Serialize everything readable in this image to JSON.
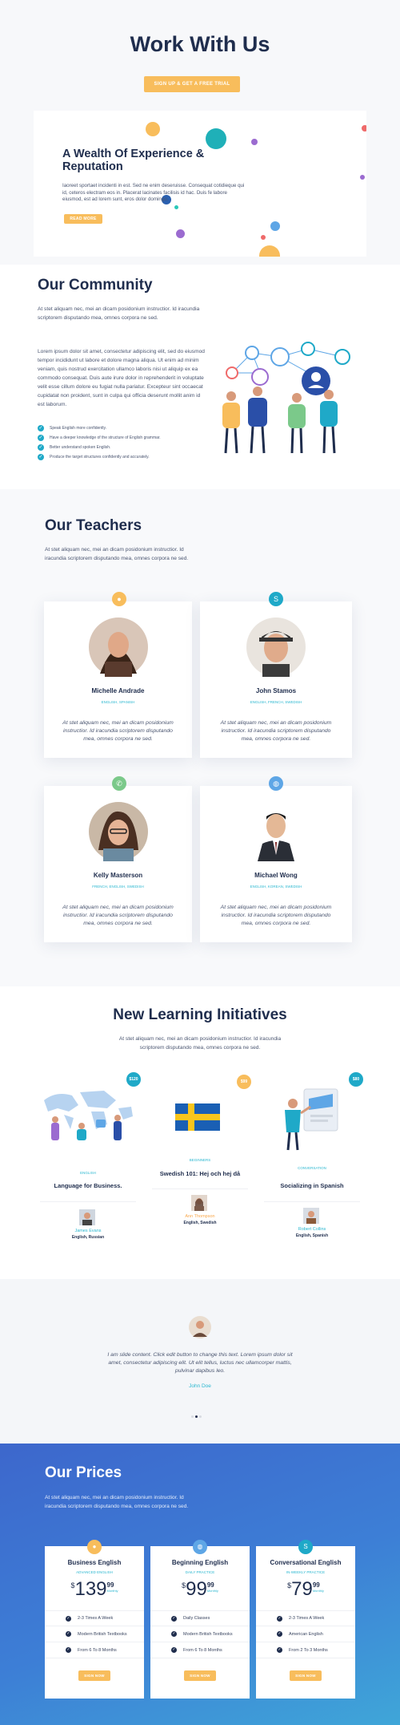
{
  "hero": {
    "title": "Work With Us",
    "cta": "SIGN UP & GET A FREE TRIAL"
  },
  "slider": {
    "heading": "A Wealth Of Experience & Reputation",
    "text": "Iaoreet sportaet incidenti in est. Sed ne enim deseruisse. Consequat cotidieque qui id, ceteros electram eos in. Placerat lacinates facilisis id hac. Duis fe labore eiusmod, est ad lorem sunt, eros dolor domingo.",
    "button": "READ MORE"
  },
  "community": {
    "title": "Our Community",
    "intro": "At stet aliquam nec, mei an dicam posidonium instructior. Id iracundia scriptorem disputando mea, omnes corpora ne sed.",
    "body": "Lorem ipsum dolor sit amet, consectetur adipiscing elit, sed do eiusmod tempor incididunt ut labore et dolore magna aliqua. Ut enim ad minim veniam, quis nostrud exercitation ullamco laboris nisi ut aliquip ex ea commodo consequat. Duis aute irure dolor in reprehenderit in voluptate velit esse cillum dolore eu fugiat nulla pariatur. Excepteur sint occaecat cupidatat non proident, sunt in culpa qui officia deserunt mollit anim id est laborum.",
    "checklist": [
      "Speak English more confidently.",
      "Have a deeper knowledge of the structure of English grammar.",
      "Better understand spoken English.",
      "Produce the target structures confidently and accurately."
    ]
  },
  "teachers": {
    "title": "Our Teachers",
    "intro": "At stet aliquam nec, mei an dicam posidonium instructior. Id iracundia scriptorem disputando mea, omnes corpora ne sed.",
    "items": [
      {
        "name": "Michelle Andrade",
        "langs": "ENGLISH, SPANISH",
        "text": "At stet aliquam nec, mei an dicam posidonium instructior. Id iracundia scriptorem disputando mea, omnes corpora ne sed.",
        "icon": "chat-bubble-icon",
        "color": "#f8bd5c"
      },
      {
        "name": "John Stamos",
        "langs": "ENGLISH, FRENCH, SWEDISH",
        "text": "At stet aliquam nec, mei an dicam posidonium instructior. Id iracundia scriptorem disputando mea, omnes corpora ne sed.",
        "icon": "skype-icon",
        "color": "#1fa9c8"
      },
      {
        "name": "Kelly Masterson",
        "langs": "FRENCH, ENGLISH, SWEDISH",
        "text": "At stet aliquam nec, mei an dicam posidonium instructior. Id iracundia scriptorem disputando mea, omnes corpora ne sed.",
        "icon": "phone-icon",
        "color": "#7bc98a"
      },
      {
        "name": "Michael Wong",
        "langs": "ENGLISH, KOREAN, SWEDISH",
        "text": "At stet aliquam nec, mei an dicam posidonium instructior. Id iracundia scriptorem disputando mea, omnes corpora ne sed.",
        "icon": "chat-bubbles-icon",
        "color": "#5ea6e6"
      }
    ]
  },
  "initiatives": {
    "title": "New Learning Initiatives",
    "intro": "At stet aliquam nec, mei an dicam posidonium instructior. Id iracundia scriptorem disputando mea, omnes corpora ne sed.",
    "items": [
      {
        "price": "$120",
        "badge_color": "#1fa9c8",
        "category": "ENGLISH",
        "title": "Language for Business.",
        "author": "James Evans",
        "langs": "English, Russian"
      },
      {
        "price": "$99",
        "badge_color": "#f8bd5c",
        "category": "BEGINNERS",
        "title": "Swedish 101: Hej och hej då",
        "author": "Ann Thompson",
        "langs": "English, Swedish"
      },
      {
        "price": "$80",
        "badge_color": "#1fa9c8",
        "category": "CONVERSATION",
        "title": "Socializing in Spanish",
        "author": "Robert Collins",
        "langs": "English, Spanish"
      }
    ]
  },
  "testimonial": {
    "text": "I am slide content. Click edit button to change this text. Lorem ipsum dolor sit amet, consectetur adipiscing elit. Ut elit tellus, luctus nec ullamcorper mattis, pulvinar dapibus leo.",
    "author": "John Doe"
  },
  "prices": {
    "title": "Our Prices",
    "intro": "At stet aliquam nec, mei an dicam posidonium instructior. Id iracundia scriptorem disputando mea, omnes corpora ne sed.",
    "plans": [
      {
        "name": "Business English",
        "level": "ADVANCED ENGLISH",
        "currency": "$",
        "amount": "139",
        "cents": "99",
        "period": "Monthly",
        "features": [
          "2-3 Times A Week",
          "Modern British Textbooks",
          "From 6 To 8 Months"
        ],
        "button": "SIGN NOW",
        "icon_color": "#f8bd5c"
      },
      {
        "name": "Beginning English",
        "level": "DAILY PRACTICE",
        "currency": "$",
        "amount": "99",
        "cents": "99",
        "period": "Monthly",
        "features": [
          "Daily Classes",
          "Modern British Textbooks",
          "From 6 To 8 Months"
        ],
        "button": "SIGN NOW",
        "icon_color": "#5ea6e6"
      },
      {
        "name": "Conversational English",
        "level": "IN-WEEKLY PRACTICE",
        "currency": "$",
        "amount": "79",
        "cents": "99",
        "period": "Monthly",
        "features": [
          "2-3 Times A Week",
          "American English",
          "From 2 To 3 Months"
        ],
        "button": "SIGN NOW",
        "icon_color": "#1fa9c8"
      }
    ]
  }
}
